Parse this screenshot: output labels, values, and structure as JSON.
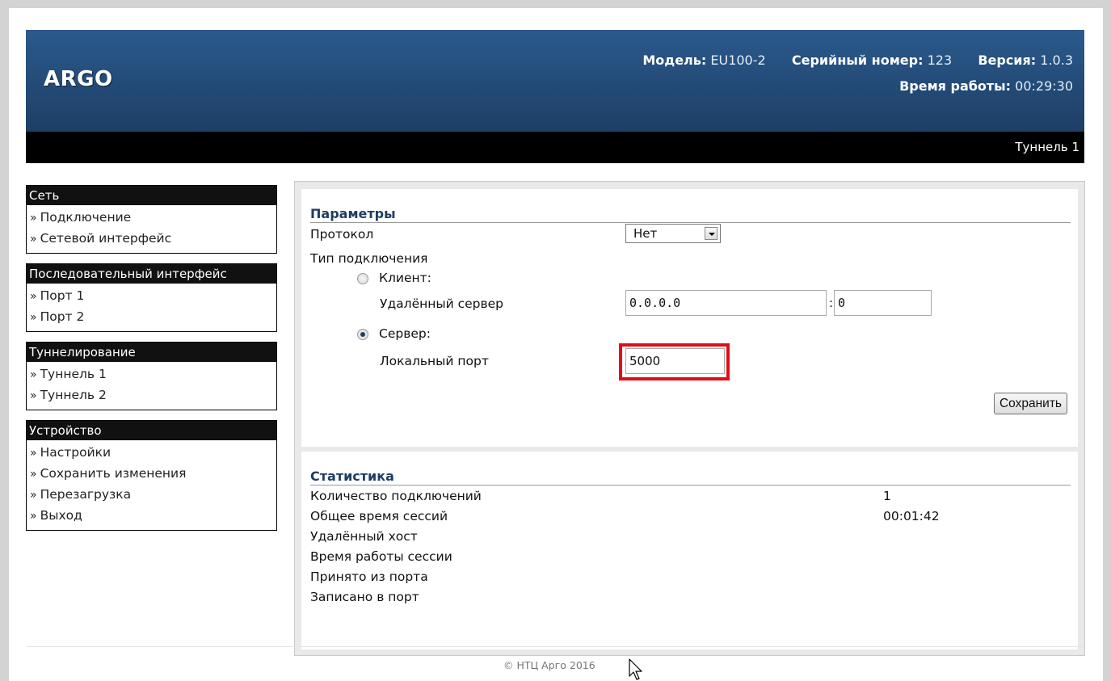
{
  "header": {
    "brand": "ARGO",
    "model_label": "Модель:",
    "model_value": "EU100-2",
    "serial_label": "Серийный номер:",
    "serial_value": "123",
    "version_label": "Версия:",
    "version_value": "1.0.3",
    "uptime_label": "Время работы:",
    "uptime_value": "00:29:30",
    "current_page": "Туннель 1"
  },
  "sidebar": {
    "groups": [
      {
        "title": "Сеть",
        "items": [
          "Подключение",
          "Сетевой интерфейс"
        ]
      },
      {
        "title": "Последовательный интерфейс",
        "items": [
          "Порт 1",
          "Порт 2"
        ]
      },
      {
        "title": "Туннелирование",
        "items": [
          "Туннель 1",
          "Туннель 2"
        ]
      },
      {
        "title": "Устройство",
        "items": [
          "Настройки",
          "Сохранить изменения",
          "Перезагрузка",
          "Выход"
        ]
      }
    ]
  },
  "params": {
    "title": "Параметры",
    "protocol_label": "Протокол",
    "protocol_value": "Нет",
    "connection_type_label": "Тип подключения",
    "client_label": "Клиент:",
    "remote_server_label": "Удалённый сервер",
    "remote_server_ip": "0.0.0.0",
    "remote_server_port": "0",
    "server_label": "Сервер:",
    "local_port_label": "Локальный порт",
    "local_port_value": "5000",
    "save_button": "Сохранить",
    "mode_selected": "server"
  },
  "stats": {
    "title": "Статистика",
    "rows": [
      {
        "label": "Количество подключений",
        "value": "1"
      },
      {
        "label": "Общее время сессий",
        "value": "00:01:42"
      },
      {
        "label": "Удалённый хост",
        "value": ""
      },
      {
        "label": "Время работы сессии",
        "value": ""
      },
      {
        "label": "Принято из порта",
        "value": ""
      },
      {
        "label": "Записано в порт",
        "value": ""
      }
    ]
  },
  "footer": {
    "copyright": "© НТЦ Арго 2016"
  },
  "colors": {
    "header_top": "#2b5a8d",
    "header_bottom": "#1d3f66",
    "nav_title_bg": "#111111",
    "panel_title": "#1f3d63",
    "highlight": "#e10e17"
  }
}
